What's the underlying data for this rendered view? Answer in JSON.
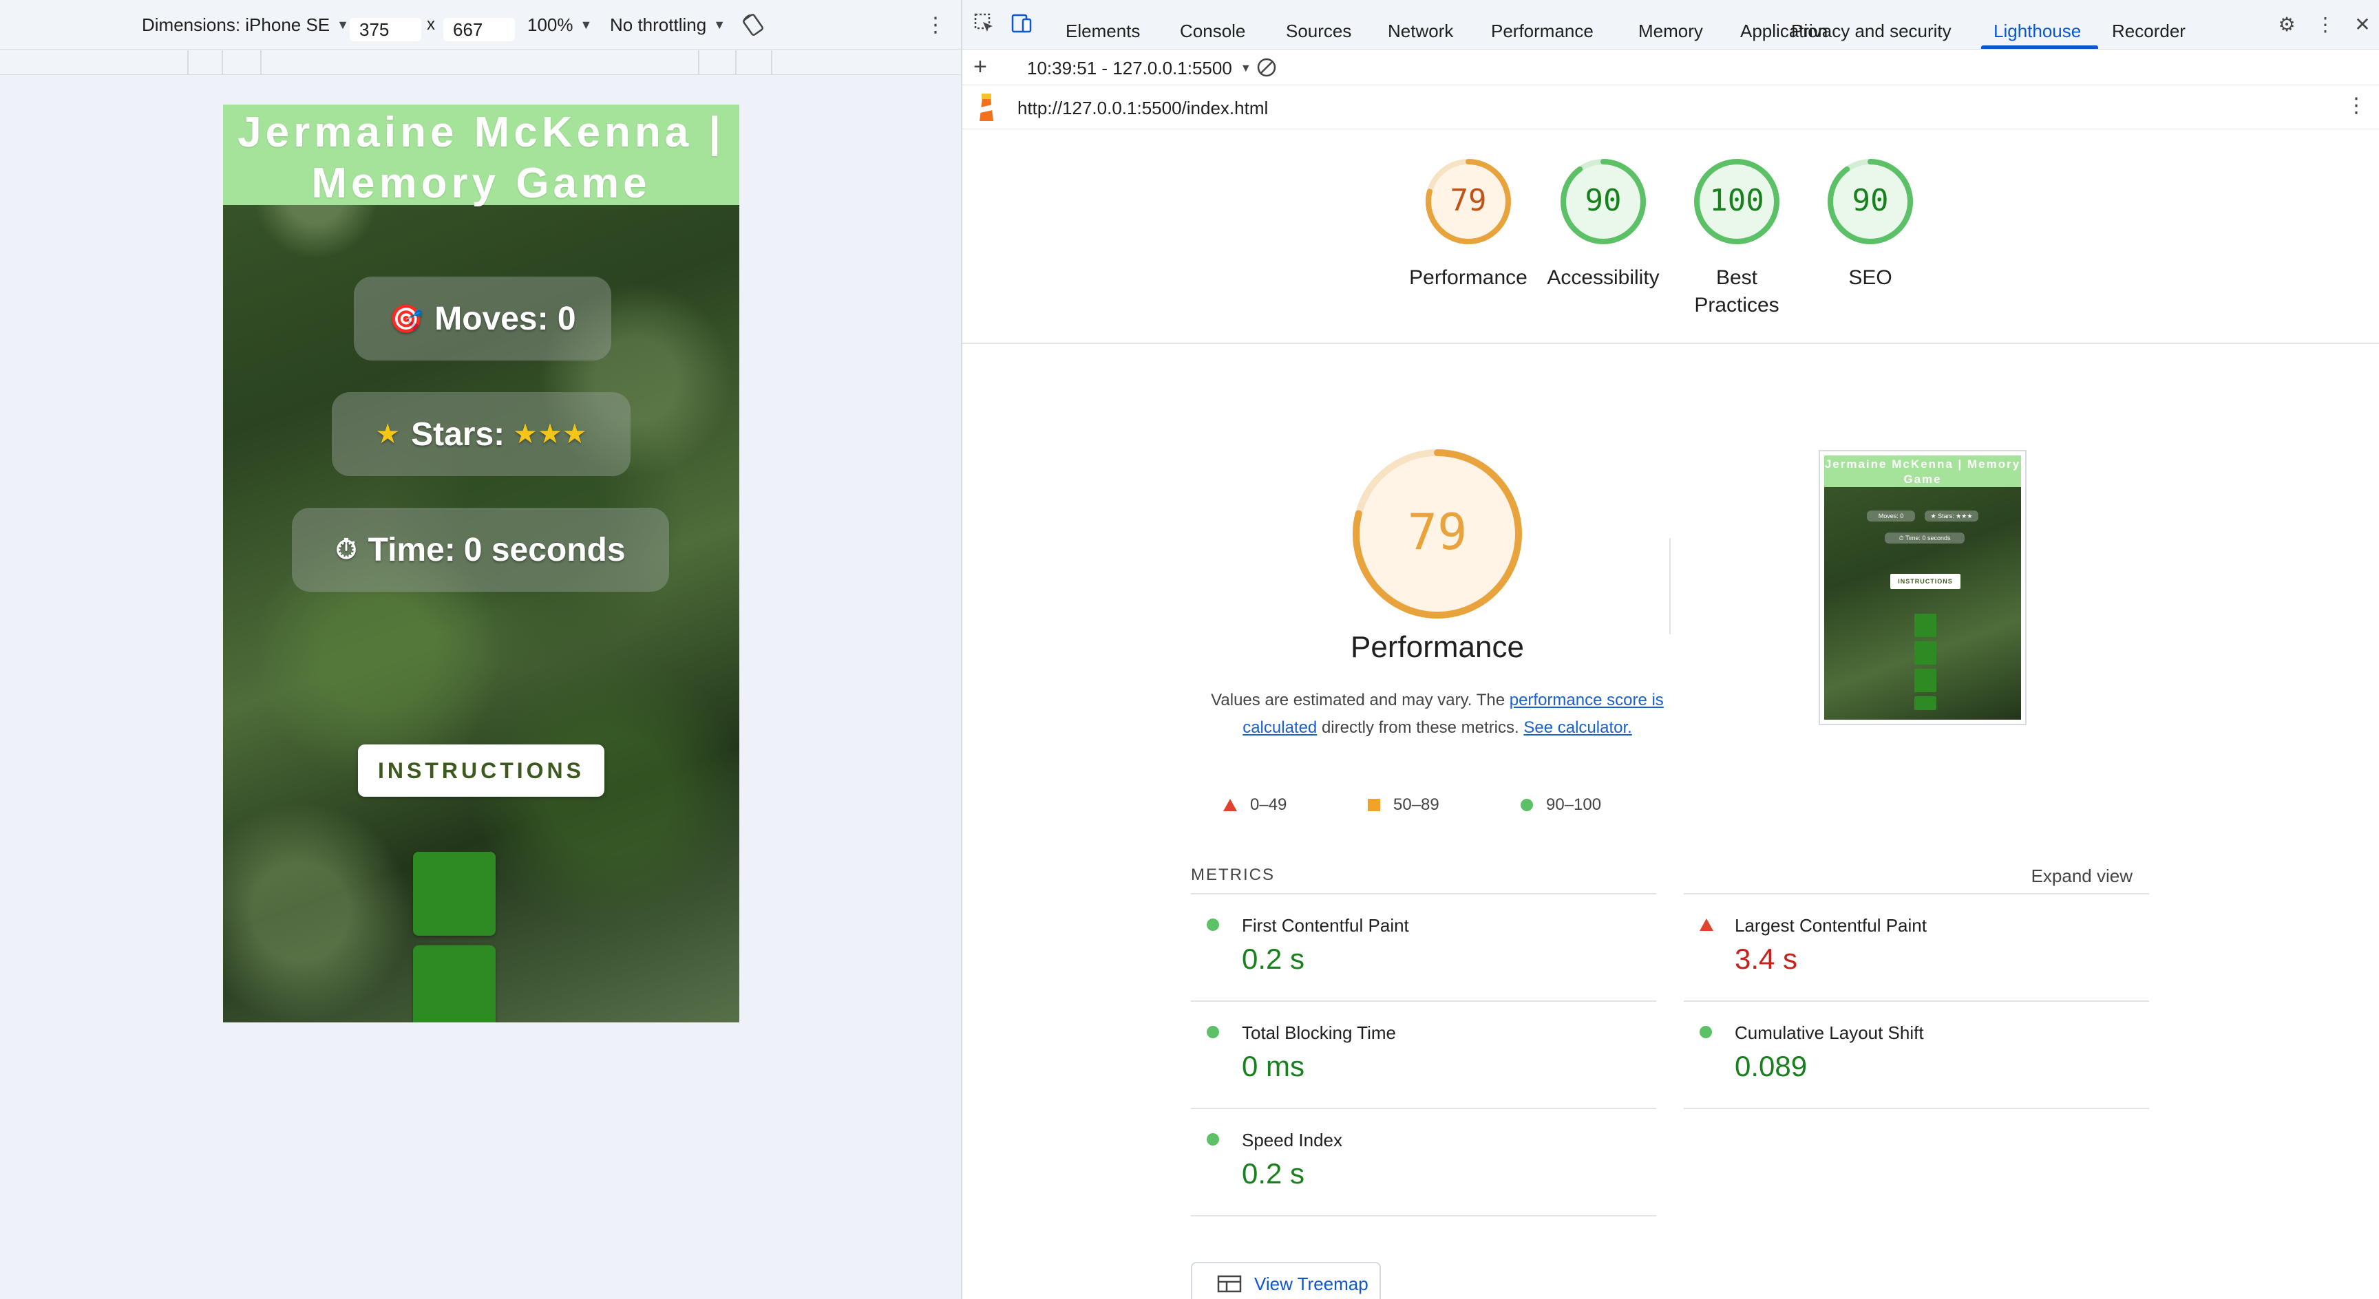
{
  "device_toolbar": {
    "dimensions_label": "Dimensions: iPhone SE",
    "width": "375",
    "times": "x",
    "height": "667",
    "zoom": "100%",
    "throttling": "No throttling"
  },
  "page": {
    "title": "Jermaine McKenna | Memory Game",
    "moves_label": "Moves: 0",
    "stars_label": "Stars:",
    "stars_value": "★★★",
    "time_label": "Time:",
    "time_value": "0 seconds",
    "instructions_button": "INSTRUCTIONS"
  },
  "devtools": {
    "tabs": [
      "Elements",
      "Console",
      "Sources",
      "Network",
      "Performance",
      "Memory",
      "Application",
      "Privacy and security",
      "Lighthouse",
      "Recorder"
    ],
    "active_tab": "Lighthouse",
    "report_selector": "10:39:51 - 127.0.0.1:5500",
    "url": "http://127.0.0.1:5500/index.html"
  },
  "lighthouse": {
    "scores": [
      {
        "label": "Performance",
        "value": 79,
        "color": "#e8a33d",
        "text_color": "#c05317",
        "bg": "#fff4e6"
      },
      {
        "label": "Accessibility",
        "value": 90,
        "color": "#5cc066",
        "text_color": "#18801d",
        "bg": "#eaf7eb"
      },
      {
        "label": "Best Practices",
        "value": 100,
        "color": "#5cc066",
        "text_color": "#18801d",
        "bg": "#eaf7eb"
      },
      {
        "label": "SEO",
        "value": 90,
        "color": "#5cc066",
        "text_color": "#18801d",
        "bg": "#eaf7eb"
      }
    ],
    "score_labels": {
      "performance": "Performance",
      "accessibility": "Accessibility",
      "best_practices_1": "Best",
      "best_practices_2": "Practices",
      "seo": "SEO"
    },
    "score_values": {
      "performance": "79",
      "accessibility": "90",
      "best_practices": "100",
      "seo": "90"
    },
    "big_score": "79",
    "performance_title": "Performance",
    "description_prefix": "Values are estimated and may vary. The ",
    "description_link1": "performance score is calculated",
    "description_middle": " directly from these metrics. ",
    "description_link2": "See calculator.",
    "legend": [
      {
        "label": "0–49",
        "color": "#e0442c"
      },
      {
        "label": "50–89",
        "color": "#f0a22b"
      },
      {
        "label": "90–100",
        "color": "#5cc066"
      }
    ],
    "metrics_title": "METRICS",
    "expand_view": "Expand view",
    "metrics": [
      {
        "name": "First Contentful Paint",
        "value": "0.2 s",
        "status": "good"
      },
      {
        "name": "Largest Contentful Paint",
        "value": "3.4 s",
        "status": "bad"
      },
      {
        "name": "Total Blocking Time",
        "value": "0 ms",
        "status": "good"
      },
      {
        "name": "Cumulative Layout Shift",
        "value": "0.089",
        "status": "good"
      },
      {
        "name": "Speed Index",
        "value": "0.2 s",
        "status": "good"
      }
    ],
    "view_treemap": "View Treemap",
    "thumbnail": {
      "title": "Jermaine McKenna | Memory Game",
      "moves": "Moves: 0",
      "stars": "★ Stars: ★★★",
      "time": "⏱ Time: 0 seconds",
      "button": "INSTRUCTIONS"
    }
  },
  "colors": {
    "accent": "#0b57d0",
    "header_green": "#a5e39a",
    "card_green": "#2e8a22",
    "good": "#18801d",
    "bad": "#c5221f"
  }
}
